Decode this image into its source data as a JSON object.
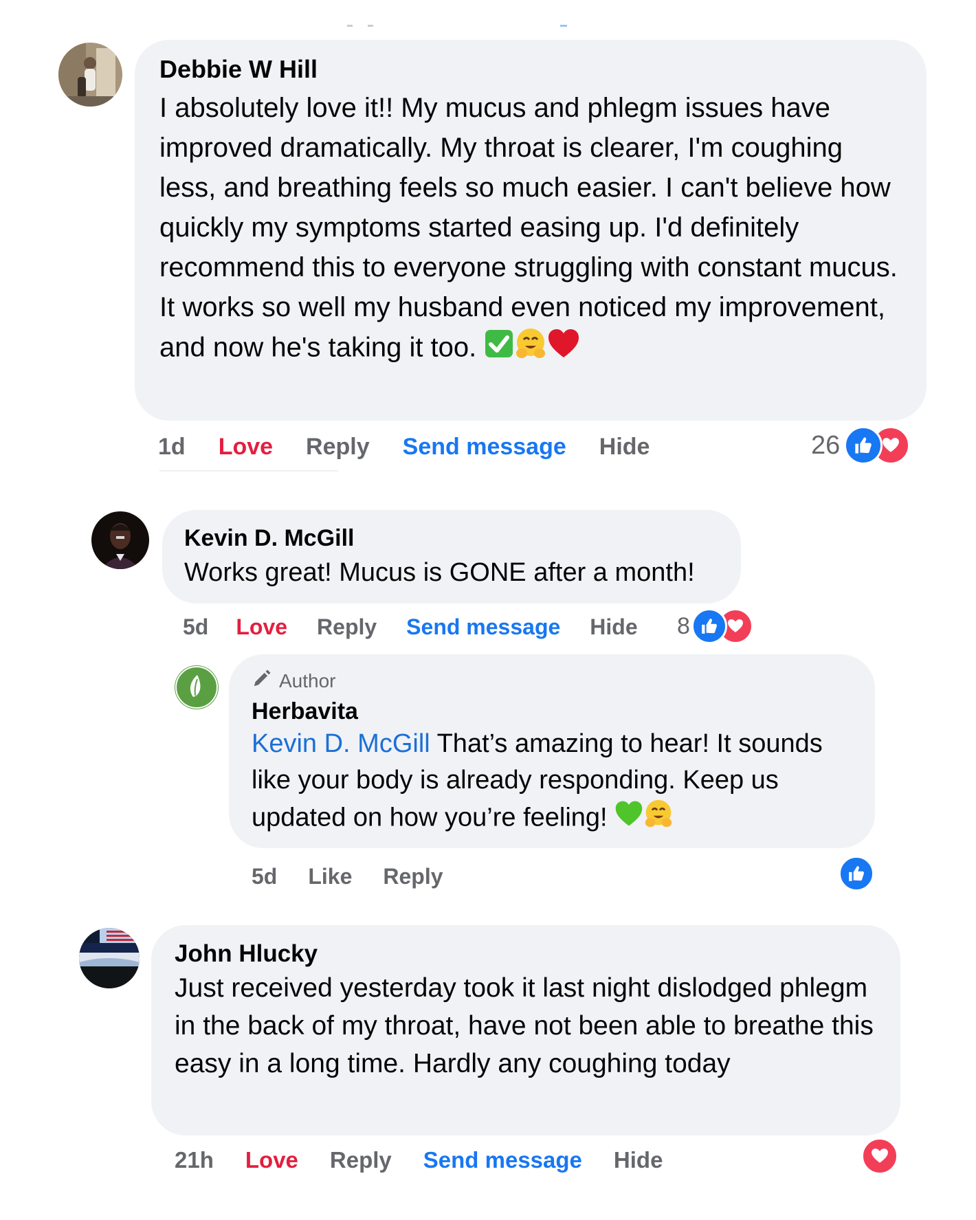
{
  "colors": {
    "bubble": "#f0f2f5",
    "love": "#e41e3f",
    "link": "#1877f2",
    "meta": "#65676b"
  },
  "comments": [
    {
      "author": "Debbie W Hill",
      "text": "I absolutely love it!! My mucus and phlegm issues have improved dramatically. My throat is clearer, I'm coughing less, and breathing feels so much easier. I can't believe how quickly my symptoms started easing up. I'd definitely recommend this to everyone struggling with constant mucus. It works so well my husband even noticed my improvement, and now he's taking it too.",
      "emojis": [
        "check-mark-emoji",
        "hugging-face-emoji",
        "red-heart-emoji"
      ],
      "time": "1d",
      "love": "Love",
      "reply": "Reply",
      "send": "Send message",
      "hide": "Hide",
      "reaction_count": "26",
      "reaction_icons": [
        "like-reaction-icon",
        "love-reaction-icon"
      ]
    },
    {
      "author": "Kevin D. McGill",
      "text": "Works great! Mucus is GONE after a month!",
      "time": "5d",
      "love": "Love",
      "reply": "Reply",
      "send": "Send message",
      "hide": "Hide",
      "reaction_count": "8",
      "reaction_icons": [
        "like-reaction-icon",
        "love-reaction-icon"
      ]
    },
    {
      "badge": "Author",
      "author": "Herbavita",
      "mention": "Kevin D. McGill",
      "text": "That’s amazing to hear! It sounds like your body is already responding. Keep us updated on how you’re feeling!",
      "emojis": [
        "green-heart-emoji",
        "hugging-face-emoji"
      ],
      "time": "5d",
      "like": "Like",
      "reply": "Reply",
      "reaction_icons": [
        "like-reaction-icon"
      ]
    },
    {
      "author": "John Hlucky",
      "text": "Just received yesterday took it last night dislodged phlegm in the back of my throat, have not been able to breathe this easy in a long time. Hardly any coughing today",
      "time": "21h",
      "love": "Love",
      "reply": "Reply",
      "send": "Send message",
      "hide": "Hide",
      "reaction_icons": [
        "love-reaction-icon"
      ]
    }
  ]
}
